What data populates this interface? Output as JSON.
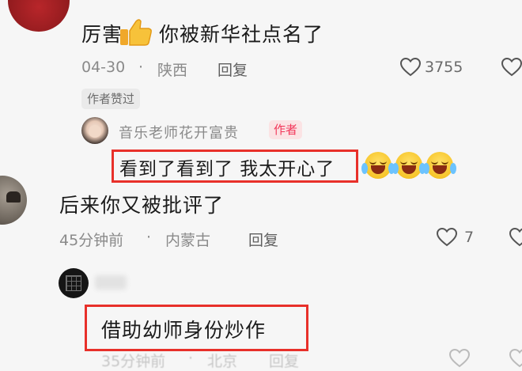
{
  "comments": [
    {
      "text_before_icon": "厉害",
      "text_after_icon": "你被新华社点名了",
      "date": "04-30",
      "separator": "·",
      "location": "陕西",
      "reply_label": "回复",
      "likes": "3755",
      "badge": "作者赞过"
    },
    {
      "text": "后来你又被批评了",
      "date": "45分钟前",
      "separator": "·",
      "location": "内蒙古",
      "reply_label": "回复",
      "likes": "7"
    },
    {
      "text": "借助幼师身份炒作",
      "date": "35分钟前",
      "separator": "·",
      "location": "北京",
      "reply_label": "回复"
    }
  ],
  "author_reply": {
    "name": "音乐老师花开富贵",
    "tag": "作者",
    "text": "看到了看到了 我太开心了"
  },
  "colors": {
    "annotation_box": "#e8302a",
    "author_tag_text": "#f2375a",
    "author_tag_bg": "#fbe3e4"
  },
  "icons": [
    "thumbs-up-icon",
    "heart-outline-icon",
    "laughing-tears-emoji"
  ]
}
